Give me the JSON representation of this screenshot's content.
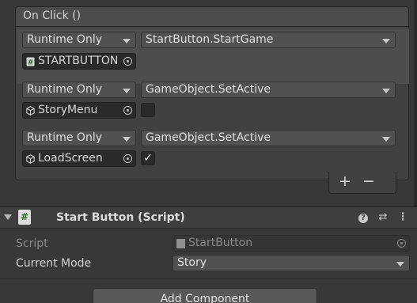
{
  "event": {
    "title": "On Click ()",
    "entries": [
      {
        "runtime": "Runtime Only",
        "function": "StartButton.StartGame",
        "object": "STARTBUTTON",
        "object_icon": "script-icon"
      },
      {
        "runtime": "Runtime Only",
        "function": "GameObject.SetActive",
        "object": "StoryMenu",
        "object_icon": "cube-icon",
        "toggle_checked": false
      },
      {
        "runtime": "Runtime Only",
        "function": "GameObject.SetActive",
        "object": "LoadScreen",
        "object_icon": "cube-icon",
        "toggle_checked": true,
        "toggle_glyph": "✓"
      }
    ],
    "add_label": "+",
    "remove_label": "−"
  },
  "component": {
    "title": "Start Button (Script)",
    "script_icon_glyph": "#",
    "help_glyph": "?",
    "presets_glyph": "⇄",
    "menu_glyph": "⋮",
    "script_label": "Script",
    "script_value": "StartButton",
    "mode_label": "Current Mode",
    "mode_value": "Story"
  },
  "add_component_label": "Add Component",
  "colors": {
    "background": "#383838",
    "panel": "#414141",
    "selected_row": "#4d4d4d",
    "field_dark": "#2a2a2a",
    "script_icon_green": "#2b6e2b"
  }
}
